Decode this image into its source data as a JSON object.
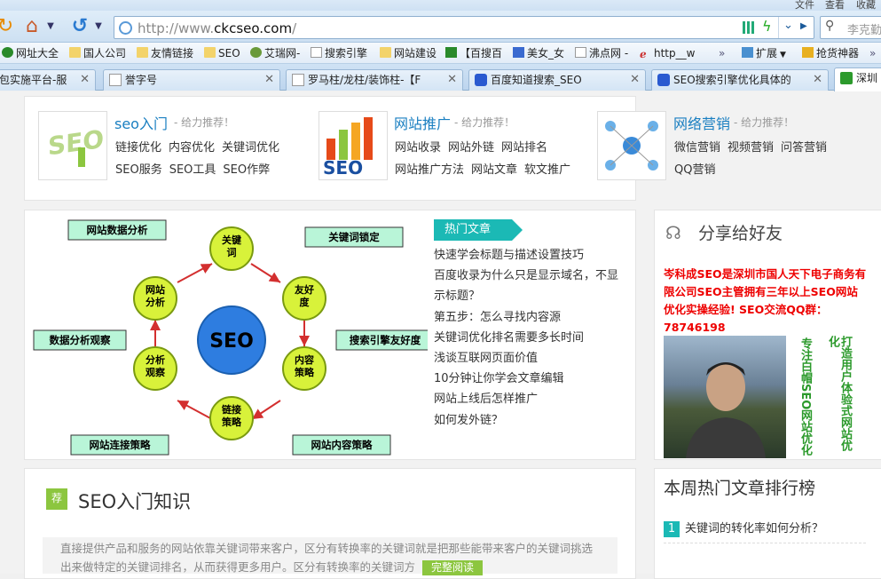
{
  "menubar": {
    "file": "文件",
    "view": "查看",
    "favorites": "收藏"
  },
  "address": {
    "url_prefix": "http://www.",
    "url_host": "ckcseo.com",
    "url_suffix": "/"
  },
  "search": {
    "placeholder": "李克勤"
  },
  "favorites": [
    {
      "label": "网址大全",
      "icon": "plus-green-icon"
    },
    {
      "label": "国人公司",
      "icon": "folder-icon"
    },
    {
      "label": "友情链接",
      "icon": "folder-icon"
    },
    {
      "label": "SEO",
      "icon": "folder-icon"
    },
    {
      "label": "艾瑞网-",
      "icon": "globe-icon"
    },
    {
      "label": "搜索引擎",
      "icon": "page-icon"
    },
    {
      "label": "网站建设",
      "icon": "folder-icon"
    },
    {
      "label": "【百搜百",
      "icon": "s-green-icon"
    },
    {
      "label": "美女_女",
      "icon": "q-blue-icon"
    },
    {
      "label": "沸点网 -",
      "icon": "page-icon"
    },
    {
      "label": "http__w",
      "icon": "e-red-icon"
    },
    {
      "label": "扩展",
      "icon": "puzzle-icon"
    },
    {
      "label": "抢货神器",
      "icon": "cart-icon"
    }
  ],
  "tabs": [
    {
      "label": "包实施平台-服"
    },
    {
      "label": "誉字号"
    },
    {
      "label": "罗马柱/龙柱/装饰柱-【F"
    },
    {
      "label": "百度知道搜索_SEO"
    },
    {
      "label": "SEO搜索引擎优化具体的"
    },
    {
      "label": "深圳"
    }
  ],
  "categories": [
    {
      "title": "seo入门",
      "sub": "- 给力推荐！",
      "links": [
        "链接优化",
        "内容优化",
        "关键词优化",
        "SEO服务",
        "SEO工具",
        "SEO作弊"
      ]
    },
    {
      "title": "网站推广",
      "sub": "- 给力推荐！",
      "links": [
        "网站收录",
        "网站外链",
        "网站排名",
        "网站推广方法",
        "网站文章",
        "软文推广"
      ]
    },
    {
      "title": "网络营销",
      "sub": "- 给力推荐！",
      "links": [
        "微信营销",
        "视频营销",
        "问答营销",
        "QQ营销"
      ]
    }
  ],
  "diagram": {
    "center": "SEO",
    "nodes": [
      "关键词",
      "友好度",
      "内容策略",
      "链接策略",
      "分析观察",
      "网站分析"
    ],
    "callouts": [
      "网站数据分析",
      "关键词锁定",
      "搜索引擎友好度",
      "网站内容策略",
      "网站连接策略",
      "数据分析观察"
    ]
  },
  "hot": {
    "tag": "热门文章",
    "items": [
      "快速学会标题与描述设置技巧",
      "百度收录为什么只是显示域名，不显示标题？",
      "第五步：怎么寻找内容源",
      "关键词优化排名需要多长时间",
      "浅谈互联网页面价值",
      "10分钟让你学会文章编辑",
      "网站上线后怎样推广",
      "如何发外链？"
    ]
  },
  "share": {
    "title": "分享给好友",
    "promo": "岑科成SEO是深圳市国人天下电子商务有限公司SEO主管拥有三年以上SEO网站优化实操经验! SEO交流QQ群：78746198",
    "slogan_left": "专注白帽SEO网站优化",
    "slogan_right": "打造用户体验式网站优化"
  },
  "ranking": {
    "title": "本周热门文章排行榜",
    "items": [
      {
        "num": "1",
        "text": "关键词的转化率如何分析？"
      }
    ]
  },
  "section": {
    "badge": "荐",
    "title": "SEO入门知识",
    "body": "直接提供产品和服务的网站依靠关键词带来客户，区分有转换率的关键词就是把那些能带来客户的关键词挑选出来做特定的关键词排名，从而获得更多用户。区分有转换率的关键词方",
    "more": "完整阅读"
  },
  "colors": {
    "accent": "#1bb9b5",
    "link": "#1a7fc1",
    "promo": "#e00000",
    "green": "#8cc63f"
  }
}
